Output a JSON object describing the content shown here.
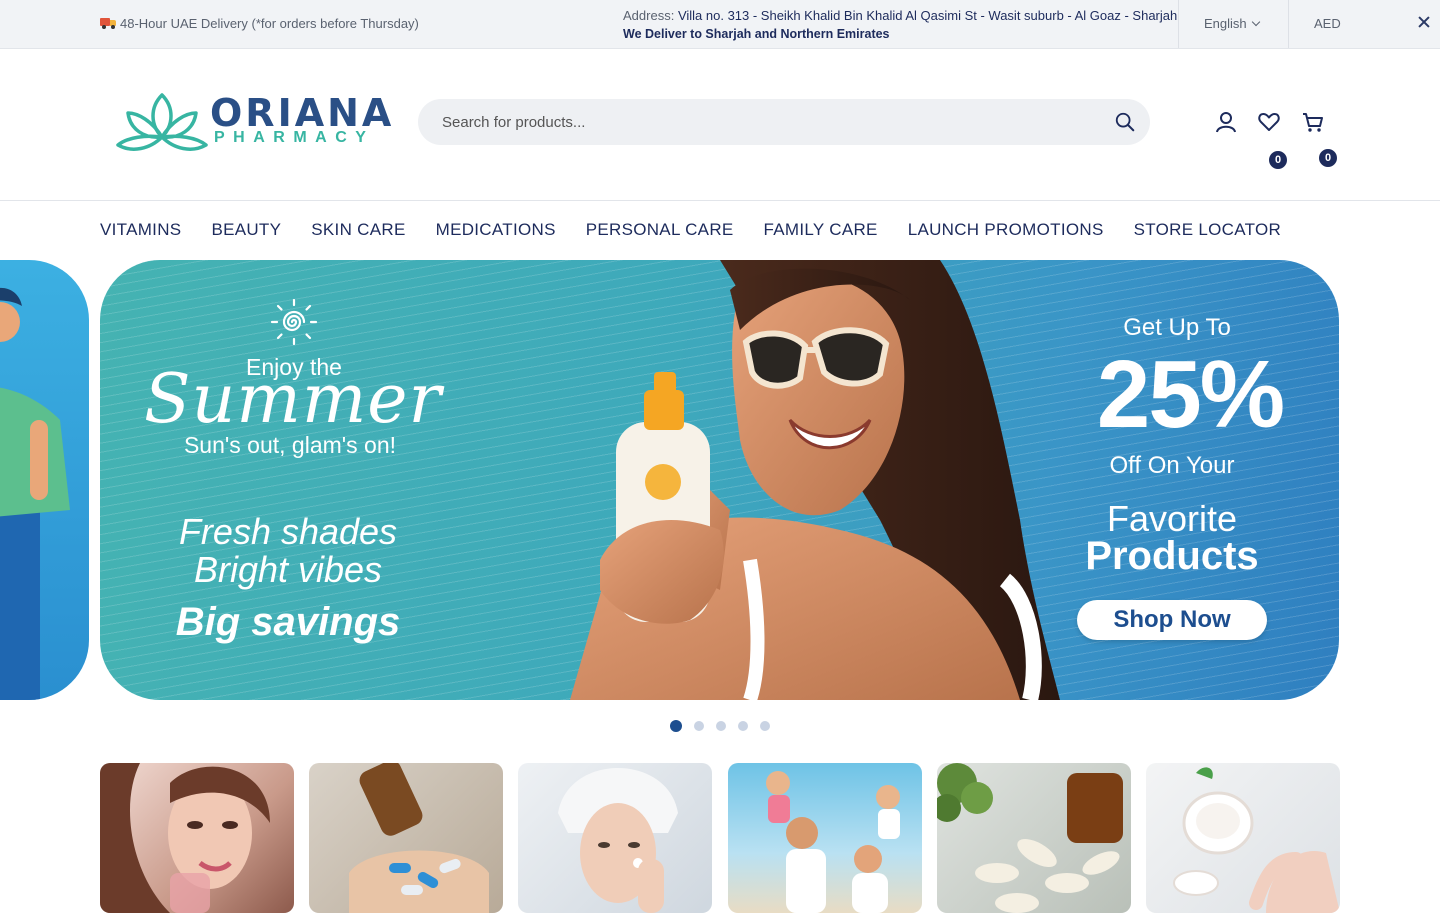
{
  "topbar": {
    "delivery_text": "48-Hour UAE Delivery (*for orders before Thursday)",
    "address_label": "Address:",
    "address_value": "Villa no. 313 - Sheikh Khalid Bin Khalid Al Qasimi St - Wasit suburb - Al Goaz - Sharjah",
    "address_line2": "We Deliver to Sharjah and Northern Emirates",
    "language": "English",
    "currency": "AED"
  },
  "header": {
    "logo_name": "ORIANA",
    "logo_sub": "PHARMACY",
    "search_placeholder": "Search for products...",
    "wishlist_count": "0",
    "cart_count": "0"
  },
  "nav": {
    "items": [
      "VITAMINS",
      "BEAUTY",
      "SKIN CARE",
      "MEDICATIONS",
      "PERSONAL CARE",
      "FAMILY CARE",
      "LAUNCH PROMOTIONS",
      "STORE LOCATOR"
    ]
  },
  "hero": {
    "enjoy": "Enjoy the",
    "summer": "Summer",
    "glam": "Sun's out, glam's on!",
    "fresh_1": "Fresh shades",
    "fresh_2": "Bright vibes",
    "savings": "Big savings",
    "get_up_to": "Get Up To",
    "percent": "25%",
    "off_on_your": "Off On Your",
    "favorite": "Favorite",
    "products": "Products",
    "shop_now": "Shop Now"
  },
  "slider": {
    "total": 5,
    "active": 1
  },
  "colors": {
    "primary": "#1d2b5c",
    "hero_teal": "#45b3b2",
    "hero_blue": "#2f7fc0",
    "logo_teal": "#37b5a2",
    "logo_blue": "#2a4f86"
  },
  "icons": [
    "truck-icon",
    "chevron-down-icon",
    "close-icon",
    "search-icon",
    "user-icon",
    "heart-icon",
    "cart-icon",
    "sun-icon"
  ]
}
